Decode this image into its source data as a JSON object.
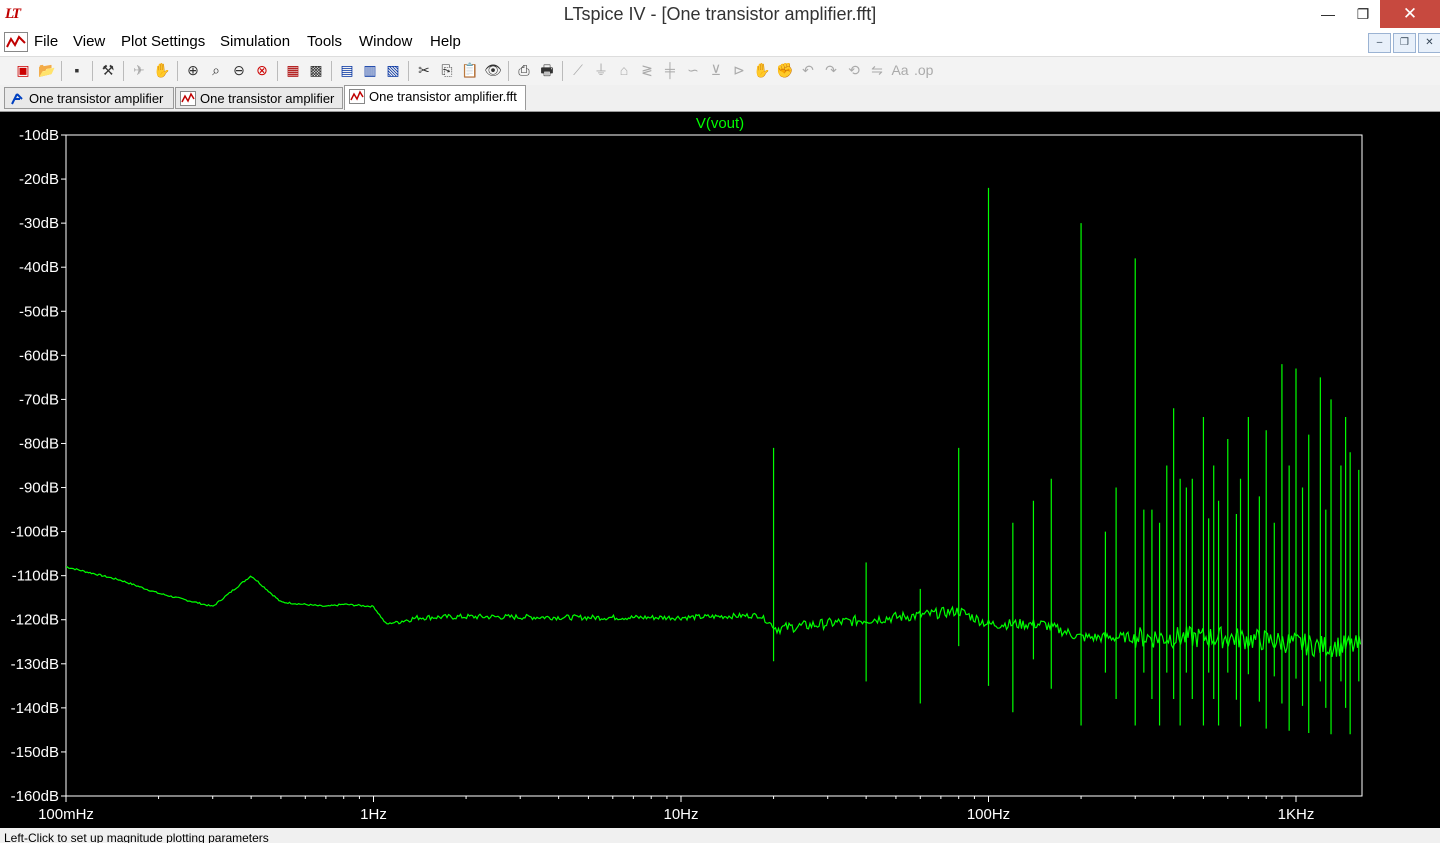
{
  "window": {
    "logo": "LT",
    "title": "LTspice IV - [One transistor amplifier.fft]",
    "minimize": "—",
    "maximize": "❐",
    "close": "✕"
  },
  "menu": {
    "items": [
      "File",
      "View",
      "Plot Settings",
      "Simulation",
      "Tools",
      "Window",
      "Help"
    ]
  },
  "tabs": [
    {
      "label": "One transistor amplifier",
      "icon": "schematic-icon"
    },
    {
      "label": "One transistor amplifier",
      "icon": "waveform-icon"
    },
    {
      "label": "One transistor amplifier.fft",
      "icon": "waveform-icon",
      "active": true
    }
  ],
  "plot": {
    "trace_label": "V(vout)",
    "trace_color": "#00ff00",
    "background": "#000000"
  },
  "chart_data": {
    "type": "line",
    "title": "V(vout)",
    "x_scale": "log",
    "y_unit": "dB",
    "xlim": [
      0.1,
      1700
    ],
    "ylim": [
      -160,
      -10
    ],
    "x_ticks": [
      "100mHz",
      "1Hz",
      "10Hz",
      "100Hz",
      "1KHz"
    ],
    "y_ticks": [
      "-10dB",
      "-20dB",
      "-30dB",
      "-40dB",
      "-50dB",
      "-60dB",
      "-70dB",
      "-80dB",
      "-90dB",
      "-100dB",
      "-110dB",
      "-120dB",
      "-130dB",
      "-140dB",
      "-150dB",
      "-160dB"
    ],
    "series": [
      {
        "name": "V(vout)",
        "noise_floor": [
          [
            0.1,
            -108
          ],
          [
            0.15,
            -111
          ],
          [
            0.2,
            -114
          ],
          [
            0.3,
            -117
          ],
          [
            0.4,
            -110
          ],
          [
            0.5,
            -116
          ],
          [
            0.7,
            -117
          ],
          [
            0.8,
            -116.5
          ],
          [
            1.0,
            -117
          ],
          [
            1.1,
            -121
          ],
          [
            1.4,
            -119.5
          ],
          [
            2.0,
            -119.3
          ],
          [
            5.0,
            -119.5
          ],
          [
            10.0,
            -119.5
          ],
          [
            18.0,
            -119
          ],
          [
            20.5,
            -122
          ],
          [
            40.0,
            -120
          ],
          [
            60.0,
            -119
          ],
          [
            80.0,
            -118
          ],
          [
            100.0,
            -121
          ],
          [
            150.0,
            -121
          ],
          [
            200.0,
            -124
          ],
          [
            300.0,
            -124
          ],
          [
            400.0,
            -124
          ],
          [
            600.0,
            -124
          ],
          [
            900.0,
            -125
          ],
          [
            1200.0,
            -126
          ],
          [
            1700.0,
            -126
          ]
        ],
        "peaks": [
          [
            20,
            -81
          ],
          [
            40,
            -107
          ],
          [
            60,
            -113
          ],
          [
            80,
            -81
          ],
          [
            100,
            -22
          ],
          [
            120,
            -98
          ],
          [
            140,
            -93
          ],
          [
            160,
            -88
          ],
          [
            200,
            -30
          ],
          [
            240,
            -100
          ],
          [
            260,
            -90
          ],
          [
            300,
            -38
          ],
          [
            320,
            -95
          ],
          [
            340,
            -95
          ],
          [
            360,
            -98
          ],
          [
            380,
            -85
          ],
          [
            400,
            -72
          ],
          [
            420,
            -88
          ],
          [
            440,
            -90
          ],
          [
            460,
            -88
          ],
          [
            500,
            -74
          ],
          [
            520,
            -97
          ],
          [
            540,
            -85
          ],
          [
            560,
            -93
          ],
          [
            600,
            -79
          ],
          [
            640,
            -96
          ],
          [
            660,
            -88
          ],
          [
            700,
            -74
          ],
          [
            760,
            -92
          ],
          [
            800,
            -77
          ],
          [
            850,
            -98
          ],
          [
            900,
            -62
          ],
          [
            950,
            -85
          ],
          [
            1000,
            -63
          ],
          [
            1050,
            -90
          ],
          [
            1100,
            -78
          ],
          [
            1200,
            -65
          ],
          [
            1250,
            -95
          ],
          [
            1300,
            -70
          ],
          [
            1400,
            -85
          ],
          [
            1450,
            -74
          ],
          [
            1500,
            -82
          ],
          [
            1600,
            -86
          ],
          [
            1650,
            -84
          ],
          [
            1700,
            -80
          ]
        ]
      }
    ],
    "grid": false
  },
  "status": {
    "text": "Left-Click to set up magnitude plotting parameters"
  }
}
